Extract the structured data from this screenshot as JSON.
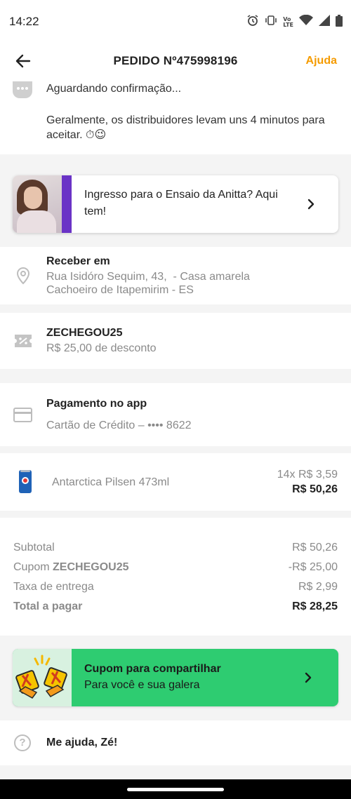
{
  "status_bar": {
    "time": "14:22",
    "icons": [
      "alarm-icon",
      "vibrate-icon",
      "volte-icon",
      "wifi-icon",
      "signal-icon",
      "battery-icon"
    ],
    "volte_text": "Vo\nLTE"
  },
  "header": {
    "title": "PEDIDO Nº475998196",
    "help_label": "Ajuda",
    "accent_color": "#f59b00"
  },
  "order_status": {
    "title": "Aguardando confirmação...",
    "description": "Geralmente, os distribuidores levam uns 4 minutos para aceitar. ⏱😉"
  },
  "promo": {
    "text": "Ingresso para o Ensaio da Anitta? Aqui tem!"
  },
  "address": {
    "title": "Receber em",
    "line1": "Rua Isidóro Sequim, 43,  - Casa amarela",
    "line2": "Cachoeiro de Itapemirim - ES"
  },
  "coupon": {
    "code": "ZECHEGOU25",
    "description": "R$ 25,00 de desconto"
  },
  "payment": {
    "title": "Pagamento no app",
    "method": "Cartão de Crédito – •••• 8622"
  },
  "items": [
    {
      "name": "Antarctica Pilsen 473ml",
      "quantity_price": "14x R$ 3,59",
      "total": "R$ 50,26"
    }
  ],
  "summary": {
    "subtotal_label": "Subtotal",
    "subtotal_value": "R$ 50,26",
    "coupon_label_prefix": "Cupom ",
    "coupon_label_code": "ZECHEGOU25",
    "coupon_value": "-R$ 25,00",
    "delivery_label": "Taxa de entrega",
    "delivery_value": "R$ 2,99",
    "total_label": "Total a pagar",
    "total_value": "R$ 28,25"
  },
  "share_coupon": {
    "title": "Cupom para compartilhar",
    "subtitle": "Para você e sua galera",
    "color": "#2ecc71"
  },
  "help": {
    "label": "Me ajuda, Zé!"
  }
}
